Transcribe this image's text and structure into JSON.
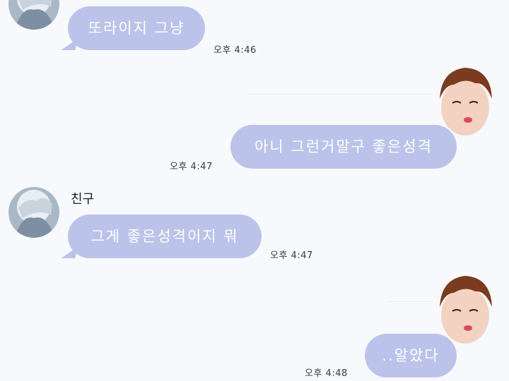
{
  "colors": {
    "background": "#f7f9fc",
    "bubble": "#bcc3ea",
    "bubble_text": "#ffffff",
    "time_text": "#3a3a3a",
    "name_text": "#1e1e1e"
  },
  "messages": [
    {
      "side": "friend",
      "text": "또라이지 그냥",
      "time": "오후 4:46"
    },
    {
      "side": "me",
      "text": "아니 그런거말구 좋은성격",
      "time": "오후 4:47"
    },
    {
      "side": "friend",
      "sender": "친구",
      "text": "그게 좋은성격이지 뭐",
      "time": "오후 4:47"
    },
    {
      "side": "me",
      "text": "..알았다",
      "time": "오후 4:48"
    }
  ]
}
